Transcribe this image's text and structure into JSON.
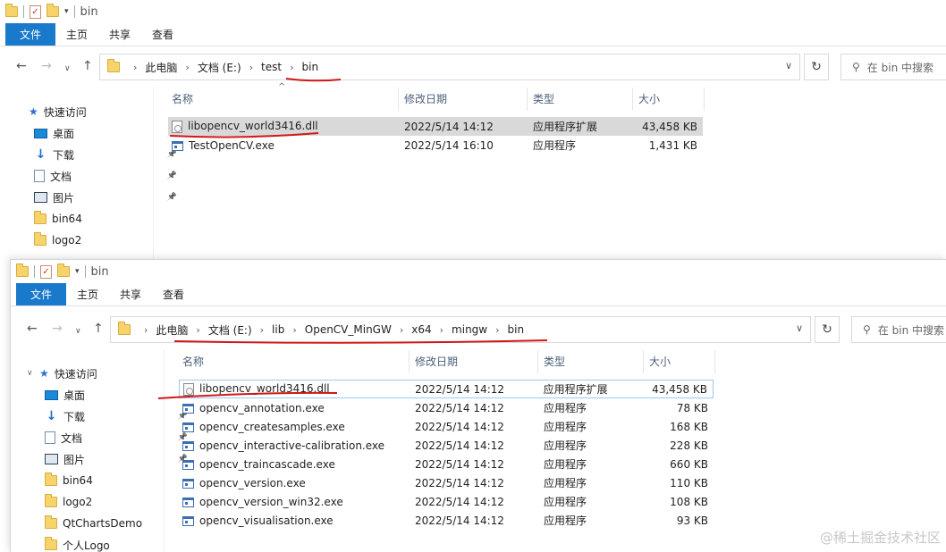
{
  "ribbon": {
    "file": "文件",
    "home": "主页",
    "share": "共享",
    "view": "查看"
  },
  "w1": {
    "title": "bin",
    "breadcrumb": [
      "此电脑",
      "文档 (E:)",
      "test",
      "bin"
    ],
    "search_placeholder": "在 bin 中搜索",
    "sidebar": [
      {
        "label": "快速访问",
        "icon": "star-icon"
      },
      {
        "label": "桌面",
        "icon": "desktop-icon",
        "pinned": true
      },
      {
        "label": "下载",
        "icon": "download-icon",
        "pinned": true
      },
      {
        "label": "文档",
        "icon": "document-icon",
        "pinned": true
      },
      {
        "label": "图片",
        "icon": "pictures-icon",
        "pinned": true
      },
      {
        "label": "bin64",
        "icon": "folder-icon"
      },
      {
        "label": "logo2",
        "icon": "folder-icon"
      }
    ],
    "columns": {
      "name": "名称",
      "modified": "修改日期",
      "type": "类型",
      "size": "大小"
    },
    "files": [
      {
        "name": "libopencv_world3416.dll",
        "modified": "2022/5/14 14:12",
        "type": "应用程序扩展",
        "size": "43,458 KB",
        "kind": "dll"
      },
      {
        "name": "TestOpenCV.exe",
        "modified": "2022/5/14 16:10",
        "type": "应用程序",
        "size": "1,431 KB",
        "kind": "exe"
      }
    ]
  },
  "w2": {
    "title": "bin",
    "breadcrumb": [
      "此电脑",
      "文档 (E:)",
      "lib",
      "OpenCV_MinGW",
      "x64",
      "mingw",
      "bin"
    ],
    "search_placeholder": "在 bin 中搜索",
    "sidebar": [
      {
        "label": "快速访问",
        "icon": "star-icon"
      },
      {
        "label": "桌面",
        "icon": "desktop-icon",
        "pinned": true
      },
      {
        "label": "下载",
        "icon": "download-icon",
        "pinned": true
      },
      {
        "label": "文档",
        "icon": "document-icon",
        "pinned": true
      },
      {
        "label": "图片",
        "icon": "pictures-icon",
        "pinned": true
      },
      {
        "label": "bin64",
        "icon": "folder-icon"
      },
      {
        "label": "logo2",
        "icon": "folder-icon"
      },
      {
        "label": "QtChartsDemo",
        "icon": "folder-icon"
      },
      {
        "label": "个人Logo",
        "icon": "folder-icon"
      }
    ],
    "columns": {
      "name": "名称",
      "modified": "修改日期",
      "type": "类型",
      "size": "大小"
    },
    "files": [
      {
        "name": "libopencv_world3416.dll",
        "modified": "2022/5/14 14:12",
        "type": "应用程序扩展",
        "size": "43,458 KB",
        "kind": "dll"
      },
      {
        "name": "opencv_annotation.exe",
        "modified": "2022/5/14 14:12",
        "type": "应用程序",
        "size": "78 KB",
        "kind": "exe"
      },
      {
        "name": "opencv_createsamples.exe",
        "modified": "2022/5/14 14:12",
        "type": "应用程序",
        "size": "168 KB",
        "kind": "exe"
      },
      {
        "name": "opencv_interactive-calibration.exe",
        "modified": "2022/5/14 14:12",
        "type": "应用程序",
        "size": "228 KB",
        "kind": "exe"
      },
      {
        "name": "opencv_traincascade.exe",
        "modified": "2022/5/14 14:12",
        "type": "应用程序",
        "size": "660 KB",
        "kind": "exe"
      },
      {
        "name": "opencv_version.exe",
        "modified": "2022/5/14 14:12",
        "type": "应用程序",
        "size": "110 KB",
        "kind": "exe"
      },
      {
        "name": "opencv_version_win32.exe",
        "modified": "2022/5/14 14:12",
        "type": "应用程序",
        "size": "108 KB",
        "kind": "exe"
      },
      {
        "name": "opencv_visualisation.exe",
        "modified": "2022/5/14 14:12",
        "type": "应用程序",
        "size": "93 KB",
        "kind": "exe"
      }
    ]
  },
  "watermark": "@稀土掘金技术社区",
  "colors": {
    "ribbon_file": "#1979ca",
    "annotation": "#d01818",
    "selection": "#d9d9d9"
  }
}
